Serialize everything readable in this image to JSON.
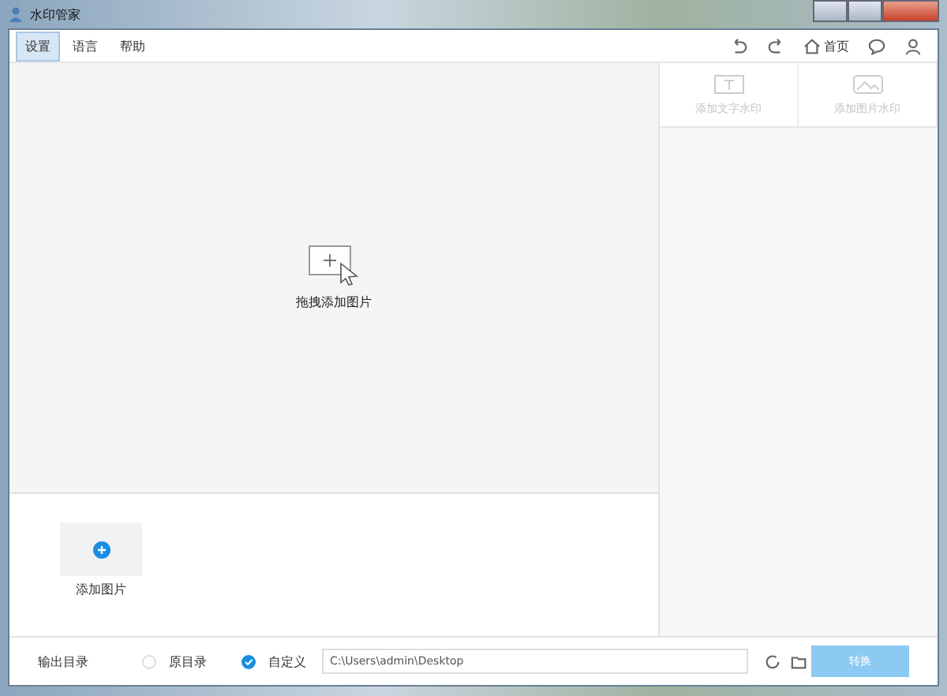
{
  "window": {
    "title": "水印管家"
  },
  "menu": [
    {
      "label": "设置",
      "selected": true
    },
    {
      "label": "语言",
      "selected": false
    },
    {
      "label": "帮助",
      "selected": false
    }
  ],
  "toolbar": {
    "home": "首页"
  },
  "side_tabs": [
    {
      "label": "添加文字水印",
      "disabled": true
    },
    {
      "label": "添加图片水印",
      "disabled": true
    }
  ],
  "drop_zone": {
    "label": "拖拽添加图片"
  },
  "thumbnails": {
    "add_label": "添加图片"
  },
  "output": {
    "label": "输出目录",
    "options": [
      {
        "label": "原目录",
        "selected": false
      },
      {
        "label": "自定义",
        "selected": true
      }
    ],
    "path": "C:\\Users\\admin\\Desktop",
    "convert": {
      "label": "转换",
      "disabled": true
    }
  }
}
